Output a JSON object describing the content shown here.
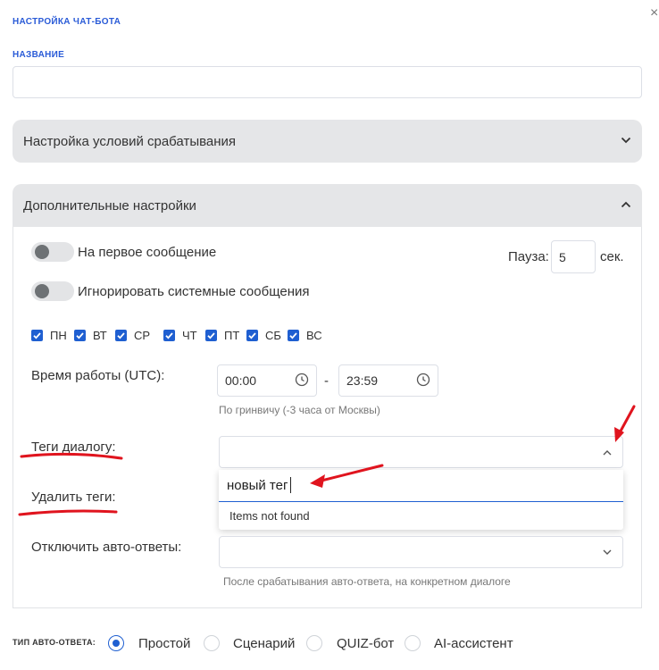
{
  "header": {
    "title": "НАСТРОЙКА ЧАТ-БОТА",
    "close_icon": "×"
  },
  "name_field": {
    "label": "НАЗВАНИЕ",
    "value": "",
    "placeholder": ""
  },
  "conditions_accordion": {
    "title": "Настройка условий срабатывания",
    "state": "collapsed"
  },
  "advanced_accordion": {
    "title": "Дополнительные настройки",
    "state": "expanded",
    "toggles": [
      {
        "label": "На первое сообщение",
        "on": false
      },
      {
        "label": "Игнорировать системные сообщения",
        "on": false
      }
    ],
    "pause": {
      "label": "Пауза:",
      "value": "5",
      "unit": "сек."
    },
    "days": [
      {
        "label": "ПН",
        "checked": true
      },
      {
        "label": "ВТ",
        "checked": true
      },
      {
        "label": "СР",
        "checked": true
      },
      {
        "label": "ЧТ",
        "checked": true
      },
      {
        "label": "ПТ",
        "checked": true
      },
      {
        "label": "СБ",
        "checked": true
      },
      {
        "label": "ВС",
        "checked": true
      }
    ],
    "work_time": {
      "label": "Время работы (UTC):",
      "from": "00:00",
      "separator": "-",
      "to": "23:59",
      "hint": "По гринвичу (-3 часа от Москвы)"
    },
    "tags": {
      "label": "Теги диалогу:",
      "value": "",
      "search_text": "новый тег",
      "no_results": "Items not found"
    },
    "remove_tags": {
      "label": "Удалить теги:"
    },
    "disable_autoreplies": {
      "label": "Отключить авто-ответы:",
      "value": "",
      "hint": "После срабатывания авто-ответа, на конкретном диалоге"
    }
  },
  "autoreply_type": {
    "label": "ТИП АВТО-ОТВЕТА:",
    "options": [
      {
        "label": "Простой",
        "selected": true
      },
      {
        "label": "Сценарий",
        "selected": false
      },
      {
        "label": "QUIZ-бот",
        "selected": false
      },
      {
        "label": "AI-ассистент",
        "selected": false
      }
    ]
  },
  "colors": {
    "accent": "#1f5fd1",
    "annotation": "#e0141e",
    "accordion_bg": "#e5e6e8"
  }
}
